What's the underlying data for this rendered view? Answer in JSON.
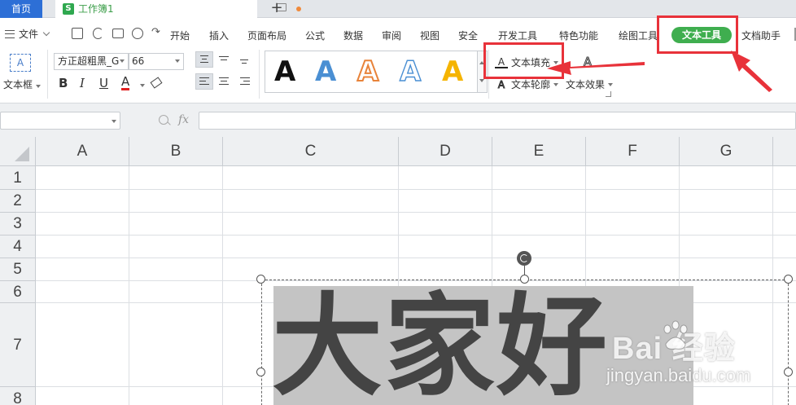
{
  "tabs": {
    "home": "首页",
    "workbook_icon": "S",
    "workbook": "工作簿1",
    "new_tab": "+"
  },
  "menu": {
    "file": "文件",
    "items": [
      "开始",
      "插入",
      "页面布局",
      "公式",
      "数据",
      "审阅",
      "视图",
      "安全",
      "开发工具",
      "特色功能",
      "绘图工具"
    ],
    "active": "文本工具",
    "assistant": "文档助手"
  },
  "ribbon": {
    "textbox_icon_text": "A",
    "textbox_label": "文本框",
    "font_name": "方正超粗黑_G",
    "font_size": "66",
    "bold": "B",
    "italic": "I",
    "underline": "U",
    "font_color": "A",
    "style_letter": "A",
    "text_fill": "文本填充",
    "text_outline": "文本轮廓",
    "text_effect": "文本效果"
  },
  "formula_bar": {
    "fx": "fx",
    "name_box": "",
    "formula": ""
  },
  "sheet": {
    "columns": [
      "A",
      "B",
      "C",
      "D",
      "E",
      "F",
      "G"
    ],
    "rows": [
      "1",
      "2",
      "3",
      "4",
      "5",
      "6",
      "7",
      "8"
    ]
  },
  "textbox_content": "大家好",
  "watermark": {
    "logo": "Bai  经验",
    "url": "jingyan.baidu.com"
  },
  "colors": {
    "accent_blue": "#2d6fd6",
    "active_green": "#3fae4f",
    "annotation_red": "#e8323a",
    "text_fill_gray": "#444444",
    "highlight_gray": "#c4c4c4",
    "style_colors": [
      "#111111",
      "#4a8fd3",
      "#e8833a",
      "#4a8fd3",
      "#f5b400"
    ]
  },
  "icons": [
    "hamburger-icon",
    "save-icon",
    "undo-icon",
    "print-icon",
    "preview-icon",
    "redo-icon",
    "monitor-icon",
    "zoom-icon",
    "rotate-icon",
    "paw-icon"
  ]
}
